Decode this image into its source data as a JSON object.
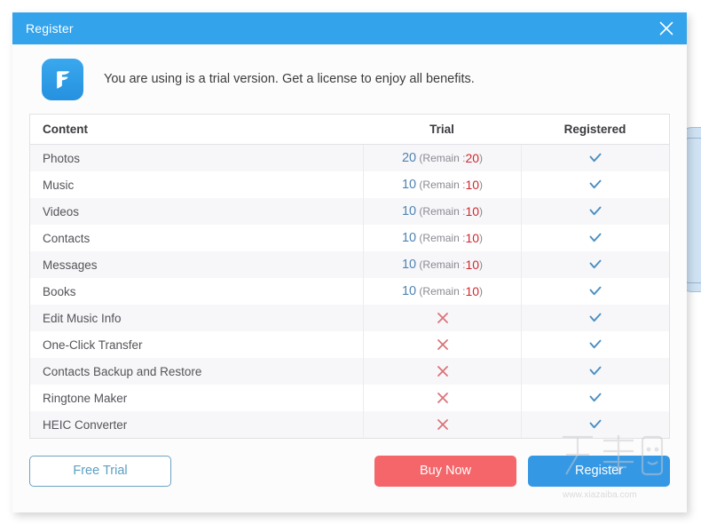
{
  "window": {
    "title": "Register",
    "close_icon": "close-icon"
  },
  "notice": {
    "logo_icon": "app-logo-icon",
    "message": "You are using is a trial version. Get a license to enjoy all benefits."
  },
  "table": {
    "columns": [
      "Content",
      "Trial",
      "Registered"
    ],
    "remain_prefix": "(Remain : ",
    "remain_suffix": ")",
    "check_icon": "check-icon",
    "cross-icon": "cross-icon",
    "rows": [
      {
        "content": "Photos",
        "trial_type": "quota",
        "trial_count": "20",
        "remain": "20",
        "registered": "check"
      },
      {
        "content": "Music",
        "trial_type": "quota",
        "trial_count": "10",
        "remain": "10",
        "registered": "check"
      },
      {
        "content": "Videos",
        "trial_type": "quota",
        "trial_count": "10",
        "remain": "10",
        "registered": "check"
      },
      {
        "content": "Contacts",
        "trial_type": "quota",
        "trial_count": "10",
        "remain": "10",
        "registered": "check"
      },
      {
        "content": "Messages",
        "trial_type": "quota",
        "trial_count": "10",
        "remain": "10",
        "registered": "check"
      },
      {
        "content": "Books",
        "trial_type": "quota",
        "trial_count": "10",
        "remain": "10",
        "registered": "check"
      },
      {
        "content": "Edit Music Info",
        "trial_type": "cross",
        "trial_count": "",
        "remain": "",
        "registered": "check"
      },
      {
        "content": "One-Click Transfer",
        "trial_type": "cross",
        "trial_count": "",
        "remain": "",
        "registered": "check"
      },
      {
        "content": "Contacts Backup and Restore",
        "trial_type": "cross",
        "trial_count": "",
        "remain": "",
        "registered": "check"
      },
      {
        "content": "Ringtone Maker",
        "trial_type": "cross",
        "trial_count": "",
        "remain": "",
        "registered": "check"
      },
      {
        "content": "HEIC Converter",
        "trial_type": "cross",
        "trial_count": "",
        "remain": "",
        "registered": "check"
      }
    ]
  },
  "footer": {
    "free_trial_label": "Free Trial",
    "buy_now_label": "Buy Now",
    "register_label": "Register"
  },
  "watermark": {
    "logo_text": "下载吧",
    "url": "www.xiazaiba.com"
  },
  "colors": {
    "titlebar_blue": "#33a3ec",
    "accent_blue": "#3498e4",
    "buy_red": "#f4666a",
    "check_blue": "#4b8fc0",
    "cross_red": "#d9747a",
    "quota_blue": "#4f83b5",
    "remain_red": "#d0282e",
    "row_stripe": "#f7f7f9"
  }
}
